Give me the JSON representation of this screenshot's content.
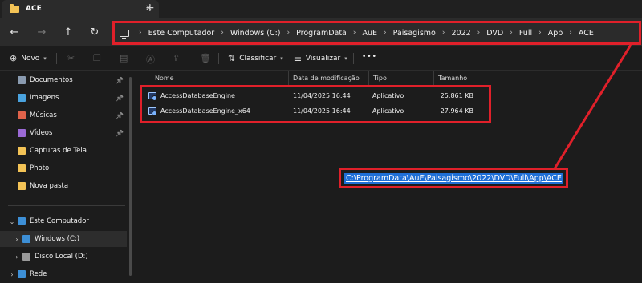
{
  "window": {
    "tab_title": "ACE",
    "tab_close_icon": "×",
    "new_tab_icon": "+"
  },
  "nav": {
    "back_icon": "←",
    "forward_icon": "→",
    "up_icon": "↑",
    "refresh_icon": "↻"
  },
  "breadcrumbs": [
    "Este Computador",
    "Windows (C:)",
    "ProgramData",
    "AuE",
    "Paisagismo",
    "2022",
    "DVD",
    "Full",
    "App",
    "ACE"
  ],
  "toolbar": {
    "new_label": "Novo",
    "sort_label": "Classificar",
    "view_label": "Visualizar",
    "more_label": "•••"
  },
  "sidebar": {
    "items": [
      {
        "label": "Documentos",
        "icon": "documents-icon",
        "color": "#8a9bb0",
        "pinned": true
      },
      {
        "label": "Imagens",
        "icon": "pictures-icon",
        "color": "#4aa3df",
        "pinned": true
      },
      {
        "label": "Músicas",
        "icon": "music-icon",
        "color": "#e0624a",
        "pinned": true
      },
      {
        "label": "Vídeos",
        "icon": "videos-icon",
        "color": "#9b6ad6",
        "pinned": true
      },
      {
        "label": "Capturas de Tela",
        "icon": "folder-icon",
        "color": "#f3c356",
        "pinned": false
      },
      {
        "label": "Photo",
        "icon": "folder-icon",
        "color": "#f3c356",
        "pinned": false
      },
      {
        "label": "Nova pasta",
        "icon": "folder-icon",
        "color": "#f3c356",
        "pinned": false
      }
    ],
    "tree": [
      {
        "label": "Este Computador",
        "icon": "computer-icon",
        "color": "#3d8fd6"
      },
      {
        "label": "Windows (C:)",
        "icon": "drive-icon",
        "color": "#3d8fd6"
      },
      {
        "label": "Disco Local (D:)",
        "icon": "drive-icon",
        "color": "#9a9a9a"
      },
      {
        "label": "Rede",
        "icon": "network-icon",
        "color": "#3d8fd6"
      }
    ]
  },
  "columns": {
    "name": "Nome",
    "modified": "Data de modificação",
    "type": "Tipo",
    "size": "Tamanho"
  },
  "files": [
    {
      "name": "AccessDatabaseEngine",
      "modified": "11/04/2025 16:44",
      "type": "Aplicativo",
      "size": "25.861 KB"
    },
    {
      "name": "AccessDatabaseEngine_x64",
      "modified": "11/04/2025 16:44",
      "type": "Aplicativo",
      "size": "27.964 KB"
    }
  ],
  "callout": {
    "path_text": "C:\\ProgramData\\AuE\\Paisagismo\\2022\\DVD\\Full\\App\\ACE"
  },
  "colors": {
    "highlight_red": "#e0202a",
    "selection_blue": "#1f6fd6"
  }
}
